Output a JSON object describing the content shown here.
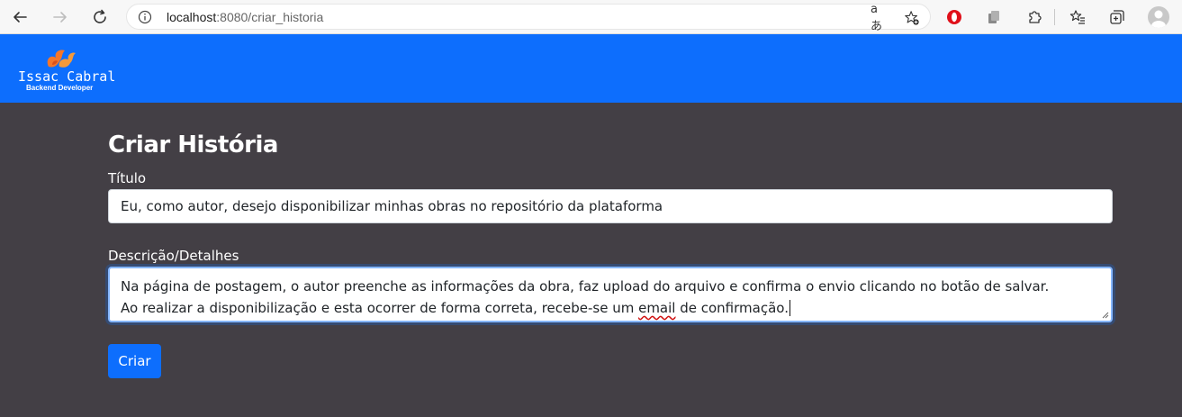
{
  "browser": {
    "url_host": "localhost",
    "url_path": ":8080/criar_historia",
    "read_aloud_glyph": "aあ"
  },
  "navbar": {
    "brand_name": "Issac Cabral",
    "brand_subtitle": "Backend Developer",
    "background_color": "#0d6efd"
  },
  "form": {
    "title": "Criar História",
    "title_label": "Título",
    "title_value": "Eu, como autor, desejo disponibilizar minhas obras no repositório da plataforma",
    "description_label": "Descrição/Detalhes",
    "description_line1": "Na página de postagem, o autor preenche as informações da obra, faz upload do arquivo e confirma o envio clicando no botão de salvar.",
    "description_line2_a": "Ao realizar a disponibilização e esta ocorrer de forma correta, recebe-se um ",
    "description_line2_spell": "email",
    "description_line2_b": " de confirmação.",
    "submit_label": "Criar"
  },
  "colors": {
    "page_background": "#433f45",
    "accent": "#0d6efd"
  }
}
